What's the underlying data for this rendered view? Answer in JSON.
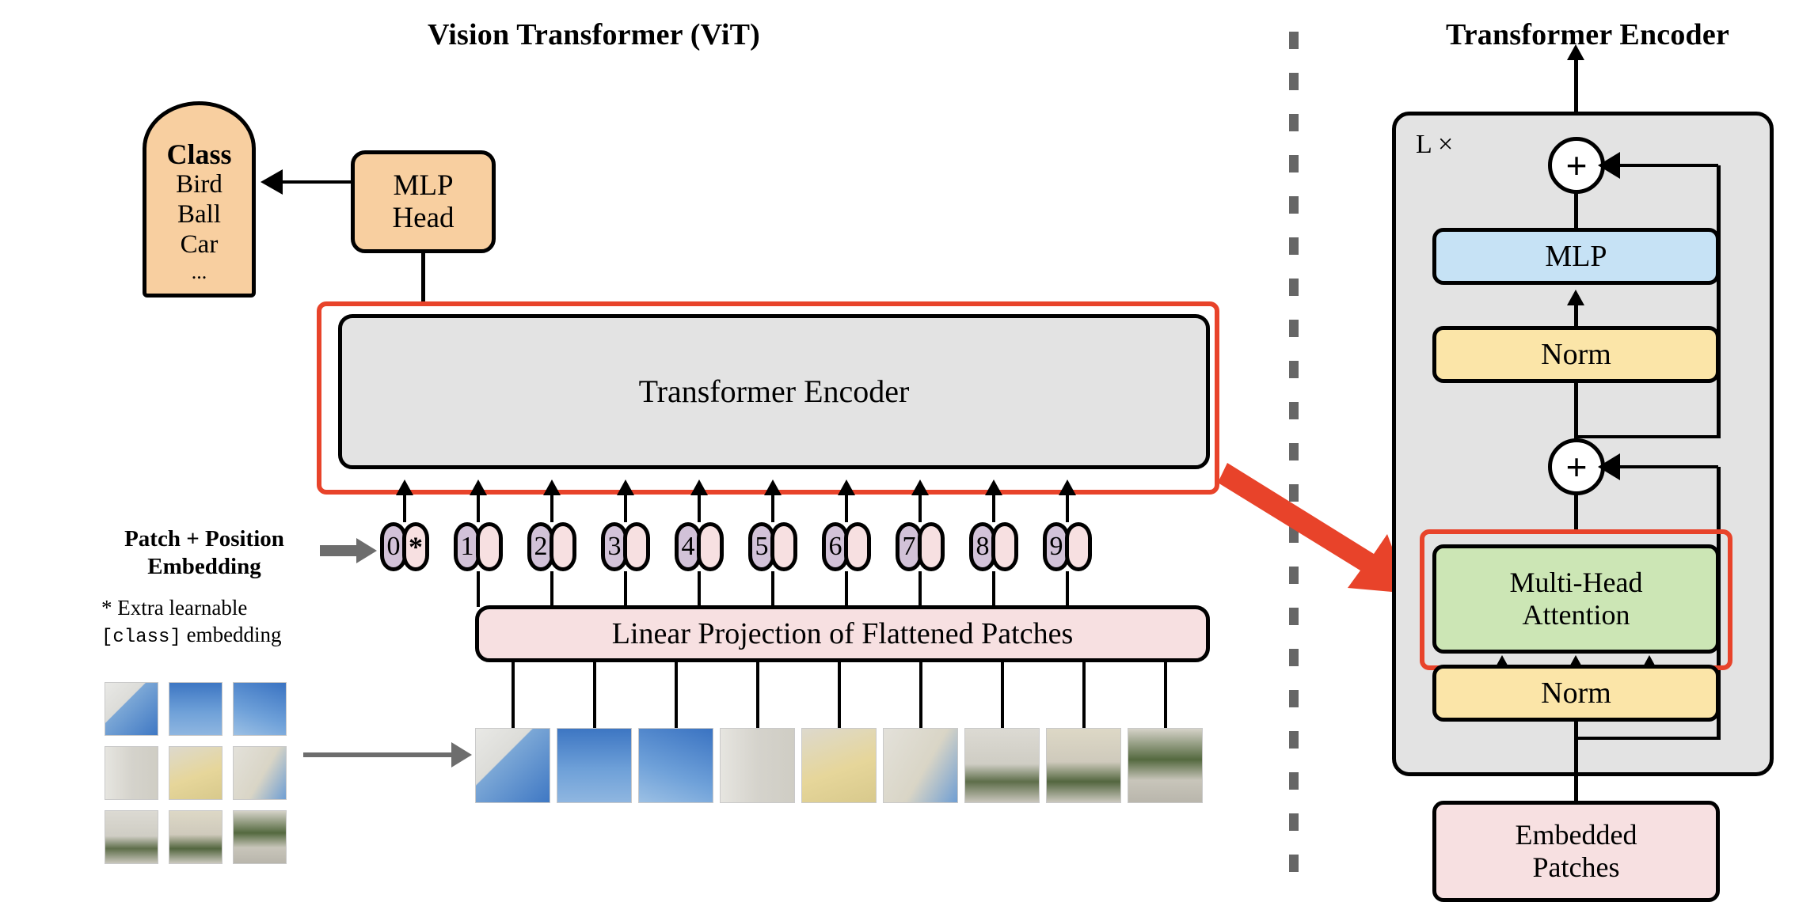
{
  "figure": {
    "left_title": "Vision Transformer (ViT)",
    "right_title": "Transformer Encoder"
  },
  "colors": {
    "orange": "#f8cfa0",
    "grey": "#e3e3e3",
    "pink": "#f7e0e1",
    "blue": "#c6e2f5",
    "yellow": "#fbe5a8",
    "green": "#cce6b5",
    "purple": "#d2c2d8",
    "highlight_red": "#e8432a",
    "divider_grey": "#666666"
  },
  "left_panel": {
    "class_box": {
      "heading": "Class",
      "items": [
        "Bird",
        "Ball",
        "Car",
        "..."
      ]
    },
    "mlp_head": "MLP\nHead",
    "encoder_block": "Transformer Encoder",
    "embedding_label": "Patch + Position\nEmbedding",
    "extra_note_line1": "* Extra learnable",
    "extra_note_class": "[class]",
    "extra_note_line2": " embedding",
    "linear_projection": "Linear Projection of Flattened Patches",
    "tokens": [
      {
        "index": "0",
        "extra": "*"
      },
      {
        "index": "1",
        "extra": ""
      },
      {
        "index": "2",
        "extra": ""
      },
      {
        "index": "3",
        "extra": ""
      },
      {
        "index": "4",
        "extra": ""
      },
      {
        "index": "5",
        "extra": ""
      },
      {
        "index": "6",
        "extra": ""
      },
      {
        "index": "7",
        "extra": ""
      },
      {
        "index": "8",
        "extra": ""
      },
      {
        "index": "9",
        "extra": ""
      }
    ],
    "source_image_grid_rows": 3,
    "source_image_grid_cols": 3,
    "patch_strip_count": 9
  },
  "right_panel": {
    "repeat_label": "L ×",
    "mlp": "MLP",
    "norm_top": "Norm",
    "attention": "Multi-Head\nAttention",
    "norm_bottom": "Norm",
    "embedded_patches": "Embedded\nPatches",
    "residual_add_top": "+",
    "residual_add_bottom": "+"
  }
}
